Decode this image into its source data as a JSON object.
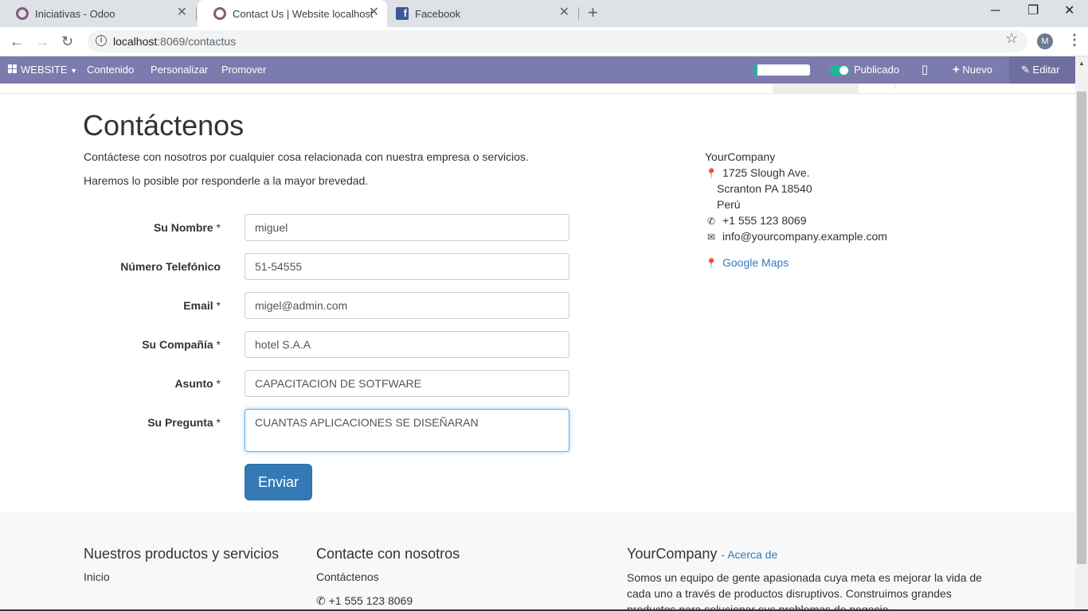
{
  "browser": {
    "tabs": [
      {
        "title": "Iniciativas - Odoo",
        "icon": "odoo-icon",
        "active": false
      },
      {
        "title": "Contact Us | Website localhost",
        "icon": "odoo-icon",
        "active": true
      },
      {
        "title": "Facebook",
        "icon": "facebook-icon",
        "active": false
      }
    ],
    "url_host": "localhost",
    "url_path": ":8069/contactus",
    "profile_initial": "M"
  },
  "odoo_bar": {
    "website_menu": "WEBSITE",
    "content": "Contenido",
    "customize": "Personalizar",
    "promote": "Promover",
    "published": "Publicado",
    "new": "Nuevo",
    "edit": "Editar"
  },
  "page": {
    "title": "Contáctenos",
    "intro1": "Contáctese con nosotros por cualquier cosa relacionada con nuestra empresa o servicios.",
    "intro2": "Haremos lo posible por responderle a la mayor brevedad."
  },
  "form": {
    "name_label": "Su Nombre",
    "name_value": "miguel",
    "phone_label": "Número Telefónico",
    "phone_value": "51-54555",
    "email_label": "Email",
    "email_value": "migel@admin.com",
    "company_label": "Su Compañía",
    "company_value": "hotel S.A.A",
    "subject_label": "Asunto",
    "subject_value": "CAPACITACION DE SOTFWARE",
    "question_label": "Su Pregunta",
    "question_value": "CUANTAS APLICACIONES SE DISEÑARAN",
    "required_mark": "*",
    "submit_label": "Enviar"
  },
  "company": {
    "name": "YourCompany",
    "street": "1725 Slough Ave.",
    "city": "Scranton PA 18540",
    "country": "Perú",
    "phone": "+1 555 123 8069",
    "email": "info@yourcompany.example.com",
    "maps": "Google Maps"
  },
  "footer": {
    "products_heading": "Nuestros productos y servicios",
    "home_link": "Inicio",
    "contact_heading": "Contacte con nosotros",
    "contact_link": "Contáctenos",
    "phone": "+1 555 123 8069",
    "about_heading": "YourCompany",
    "about_link": "- Acerca de",
    "about_text": "Somos un equipo de gente apasionada cuya meta es mejorar la vida de cada uno a través de productos disruptivos. Construimos grandes productos para solucionar sus problemas de negocio."
  },
  "colors": {
    "odoo_bar": "#7c7bad",
    "link": "#337ab7",
    "primary_button": "#337ab7",
    "toggle_on": "#21b799"
  }
}
